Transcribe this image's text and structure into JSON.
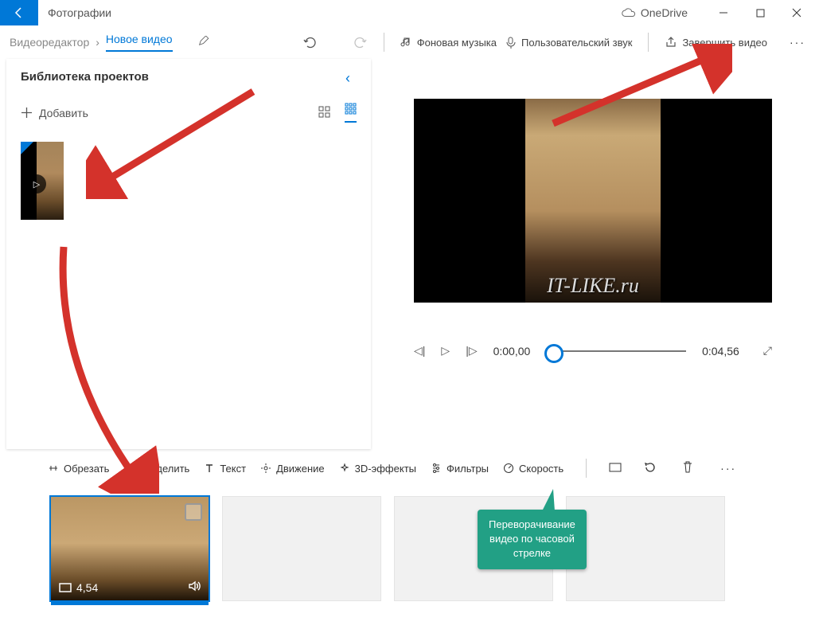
{
  "app_title": "Фотографии",
  "onedrive": "OneDrive",
  "breadcrumb": {
    "editor": "Видеоредактор",
    "current": "Новое видео"
  },
  "toolbar": {
    "bg_music": "Фоновая музыка",
    "custom_audio": "Пользовательский звук",
    "finish": "Завершить видео"
  },
  "library": {
    "title": "Библиотека проектов",
    "add": "Добавить"
  },
  "player": {
    "time_start": "0:00,00",
    "time_end": "0:04,56",
    "watermark": "IT-LIKE.ru"
  },
  "editbar": {
    "trim": "Обрезать",
    "split": "Разделить",
    "text": "Текст",
    "motion": "Движение",
    "fx3d": "3D-эффекты",
    "filters": "Фильтры",
    "speed": "Скорость"
  },
  "storyboard": {
    "clip_duration": "4,54"
  },
  "tooltip": {
    "line1": "Переворачивание",
    "line2": "видео по часовой",
    "line3": "стрелке"
  }
}
